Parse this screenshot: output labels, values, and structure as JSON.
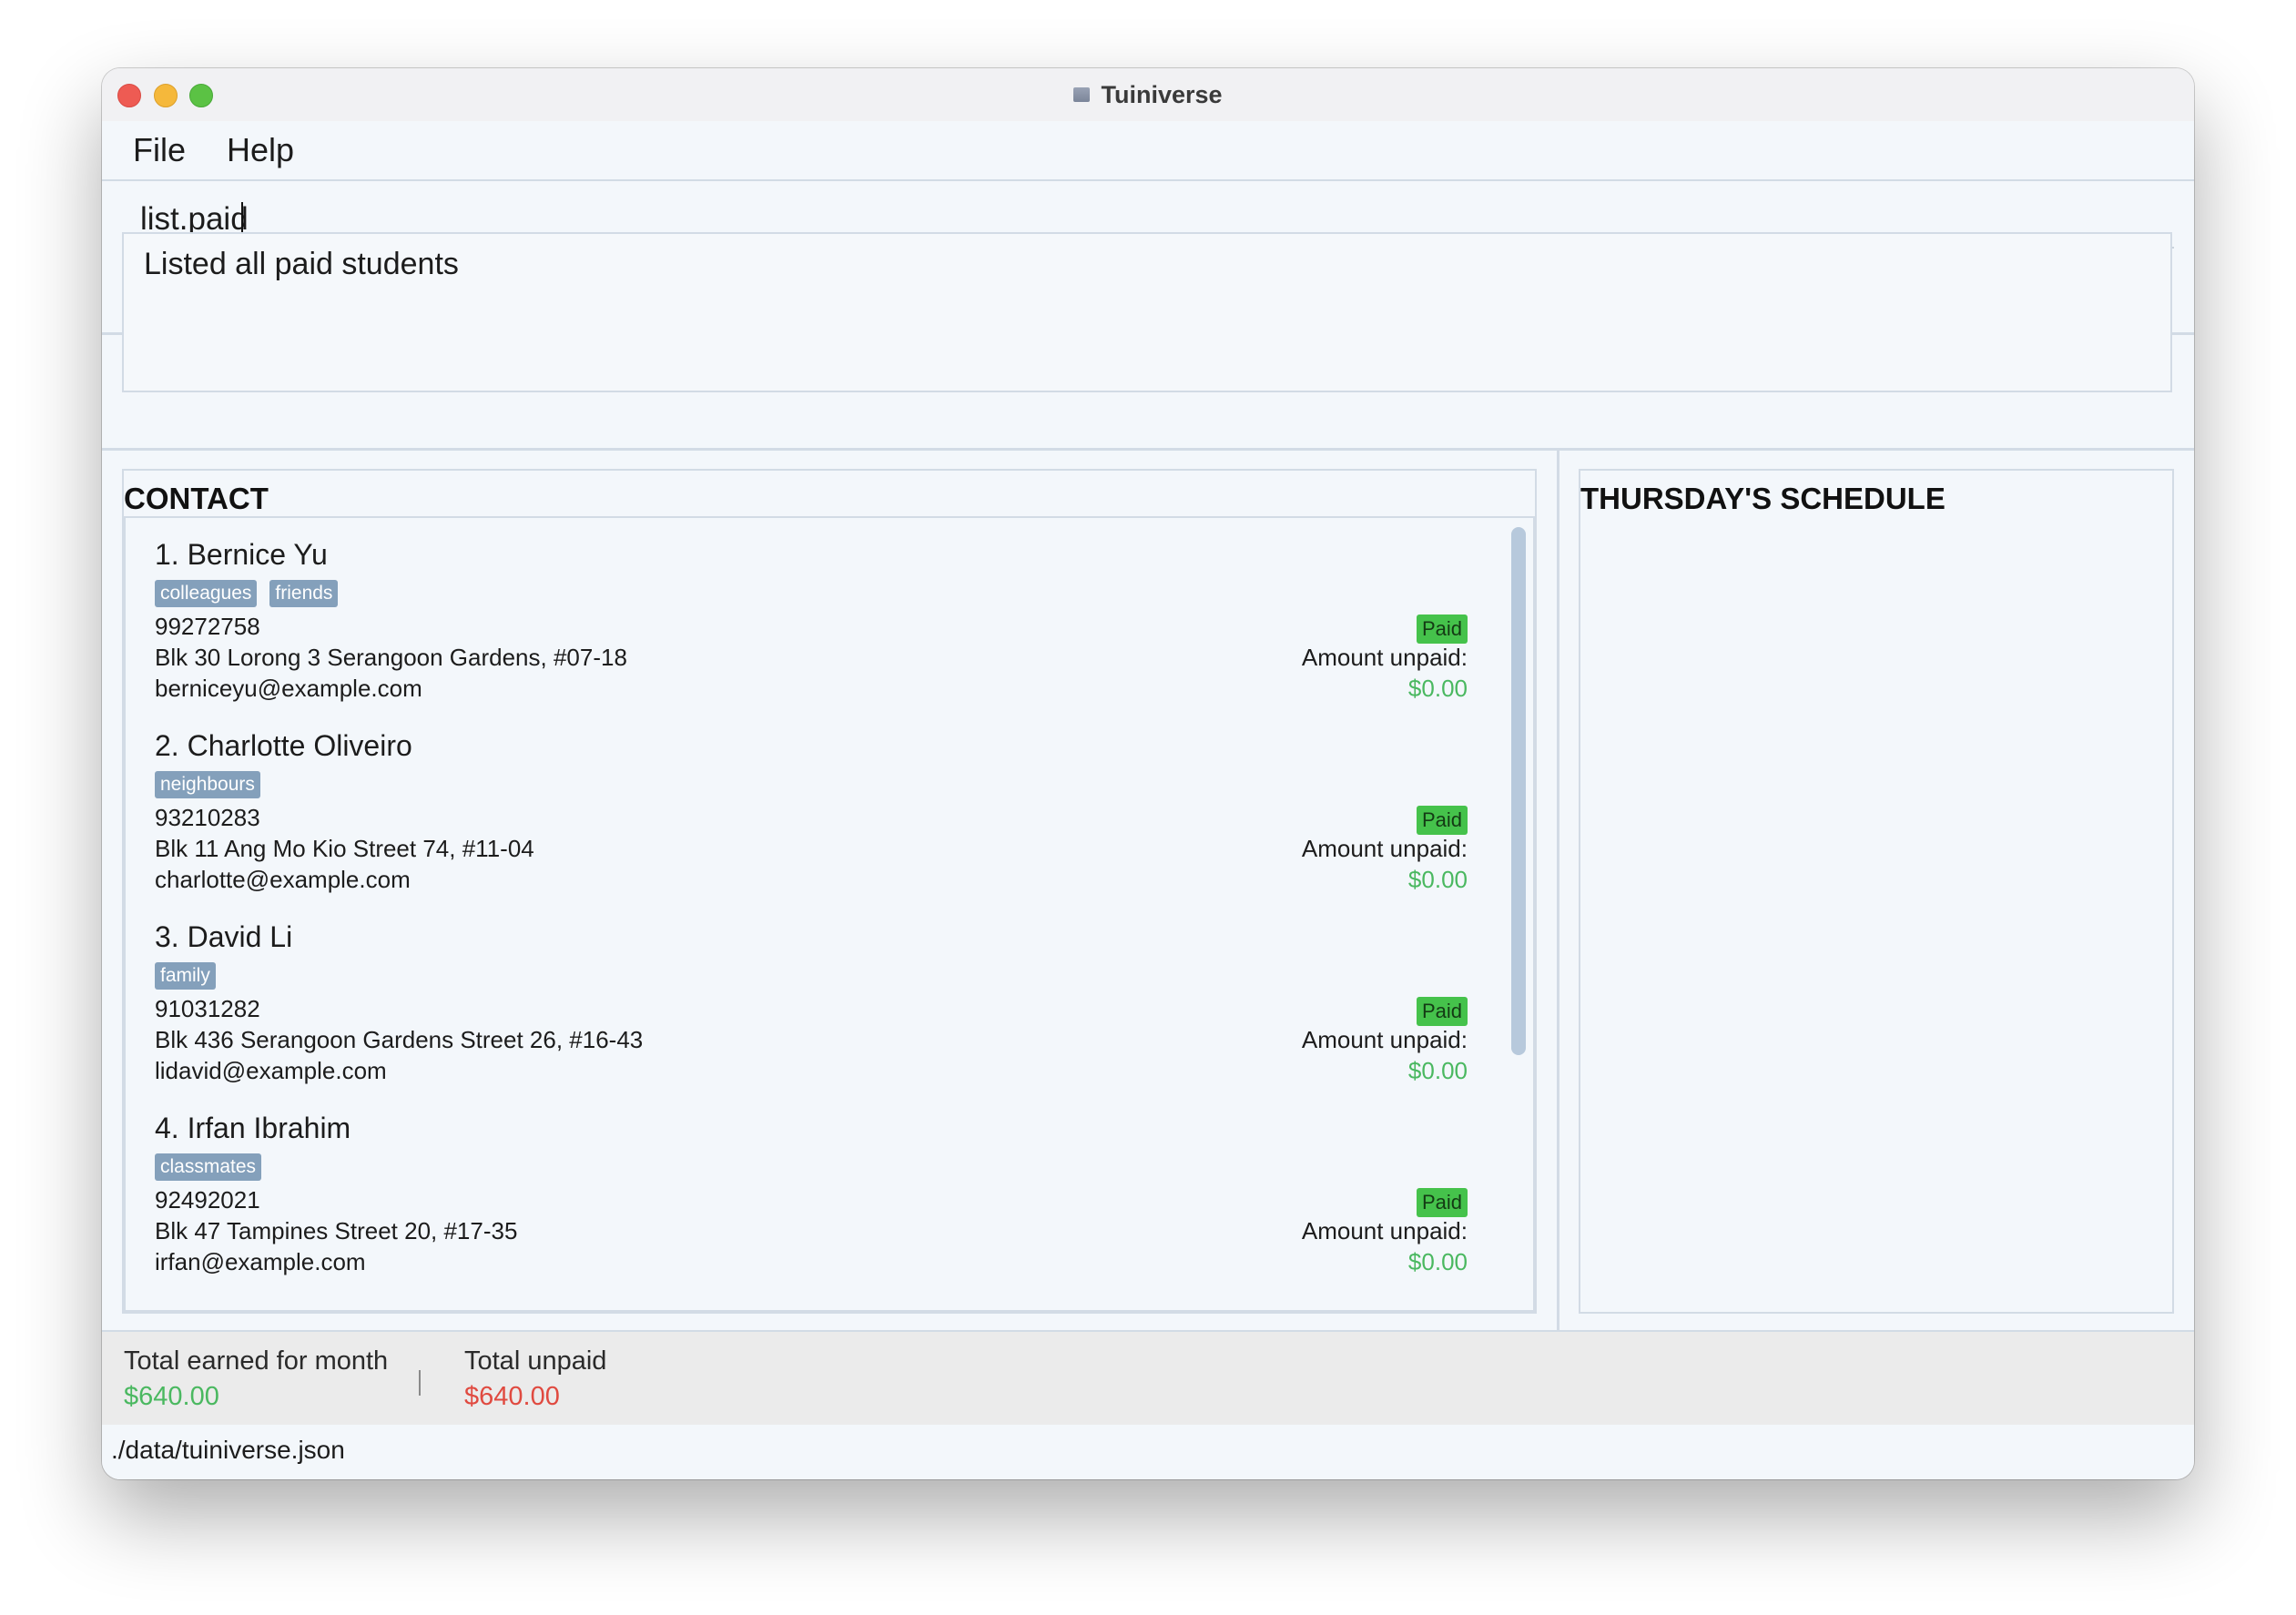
{
  "window": {
    "title": "Tuiniverse"
  },
  "menu": {
    "items": [
      "File",
      "Help"
    ]
  },
  "command": {
    "value": "list.paid"
  },
  "result": {
    "message": "Listed all paid students"
  },
  "contact_panel": {
    "title": "CONTACT",
    "students": [
      {
        "index_name": "1. Bernice Yu",
        "tags": [
          "colleagues",
          "friends"
        ],
        "phone": "99272758",
        "address": "Blk 30 Lorong 3 Serangoon Gardens, #07-18",
        "email": "berniceyu@example.com",
        "status": "Paid",
        "amount_label": "Amount unpaid:",
        "amount": "$0.00"
      },
      {
        "index_name": "2. Charlotte Oliveiro",
        "tags": [
          "neighbours"
        ],
        "phone": "93210283",
        "address": "Blk 11 Ang Mo Kio Street 74, #11-04",
        "email": "charlotte@example.com",
        "status": "Paid",
        "amount_label": "Amount unpaid:",
        "amount": "$0.00"
      },
      {
        "index_name": "3. David Li",
        "tags": [
          "family"
        ],
        "phone": "91031282",
        "address": "Blk 436 Serangoon Gardens Street 26, #16-43",
        "email": "lidavid@example.com",
        "status": "Paid",
        "amount_label": "Amount unpaid:",
        "amount": "$0.00"
      },
      {
        "index_name": "4. Irfan Ibrahim",
        "tags": [
          "classmates"
        ],
        "phone": "92492021",
        "address": "Blk 47 Tampines Street 20, #17-35",
        "email": "irfan@example.com",
        "status": "Paid",
        "amount_label": "Amount unpaid:",
        "amount": "$0.00"
      }
    ]
  },
  "schedule_panel": {
    "title": "THURSDAY'S SCHEDULE"
  },
  "summary": {
    "earned_label": "Total earned for month",
    "earned_value": "$640.00",
    "unpaid_label": "Total unpaid",
    "unpaid_value": "$640.00"
  },
  "status_bar": {
    "path": "./data/tuiniverse.json"
  },
  "colors": {
    "paid_green": "#45c24b",
    "amount_green": "#4ab860",
    "unpaid_red": "#e04a40",
    "tag_blue": "#84a0bb"
  },
  "icons": {
    "app": "tuiniverse-app-icon"
  }
}
